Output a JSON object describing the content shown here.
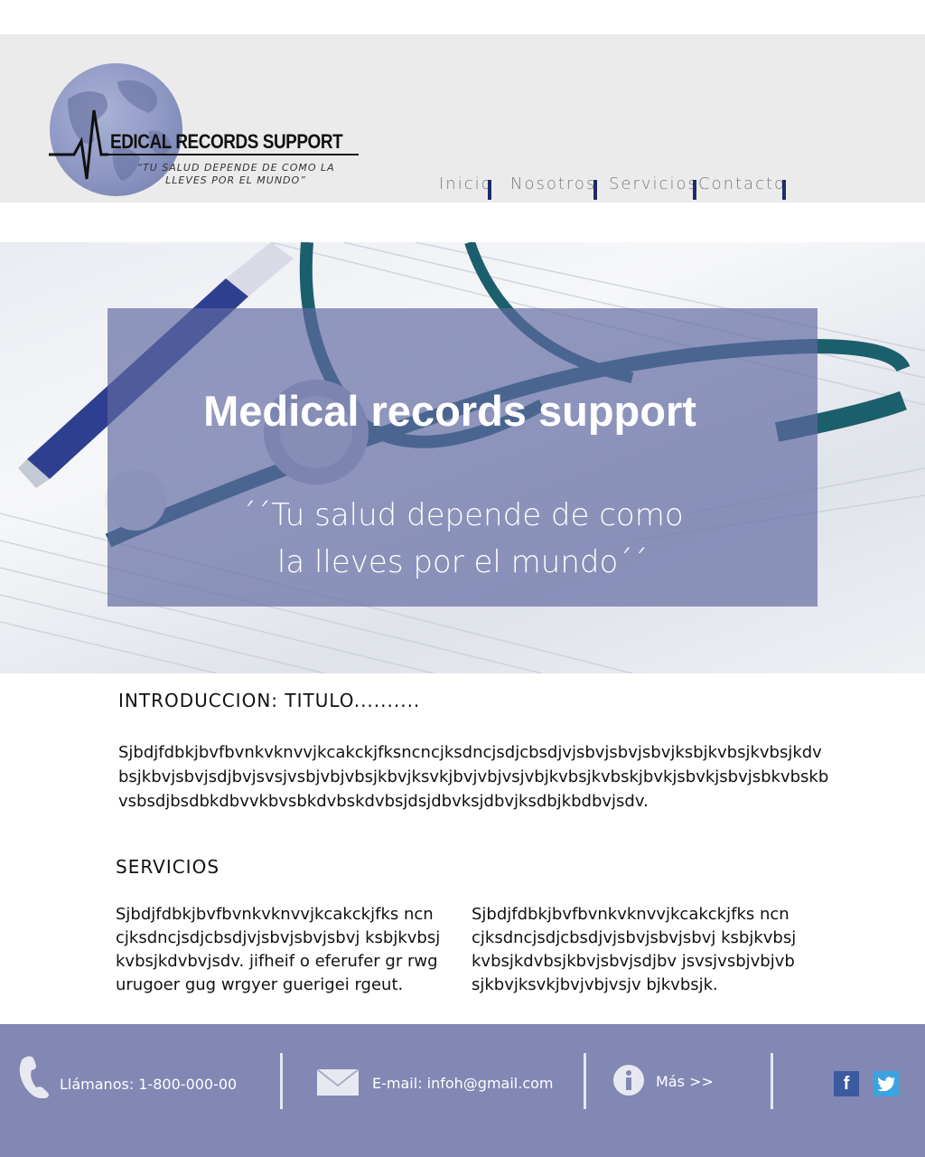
{
  "brand": {
    "logo_title": "EDICAL RECORDS SUPPORT",
    "logo_tagline_line1": "“TU SALUD DEPENDE DE COMO LA",
    "logo_tagline_line2": "LLEVES POR EL MUNDO”"
  },
  "nav": {
    "items": [
      {
        "label": "Inicio"
      },
      {
        "label": "Nosotros"
      },
      {
        "label": "Servicios"
      },
      {
        "label": "Contacto"
      }
    ]
  },
  "hero": {
    "title": "Medical records support",
    "quote_line1": "´´Tu salud depende de como",
    "quote_line2": "la lleves por el mundo´´"
  },
  "intro": {
    "title": "INTRODUCCION: TITULO..........",
    "body": "Sjbdjfdbkjbvfbvnkvknvvjkcakckjfksncncjksdncjsdjcbsdjvjsbvjsbvjsbvjksbjkvbsjkvbsjkdvbsjkbvjsbvjsdjbvjsvsjvsbjvbjvbsjkbvjksvkjbvjvbjvsjvbjkvbsjkvbskjbvkjsbvkjsbvjsbkvbskbvsbsdjbsdbkdbvvkbvsbkdvbskdvbsjdsjdbvksjdbvjksdbjkbdbvjsdv."
  },
  "services": {
    "title": "SERVICIOS",
    "col1": "Sjbdjfdbkjbvfbvnkvknvvjkcakckjfks ncncjksdncjsdjcbsdjvjsbvjsbvjsbvj ksbjkvbsjkvbsjkdvbvjsdv. jifheif o eferufer gr rwgurugoer gug wrgyer guerigei rgeut.",
    "col2": "Sjbdjfdbkjbvfbvnkvknvvjkcakckjfks ncncjksdncjsdjcbsdjvjsbvjsbvjsbvj ksbjkvbsjkvbsjkdvbsjkbvjsbvjsdjbv jsvsjvsbjvbjvbsjkbvjksvkjbvjvbjvsjv bjkvbsjk."
  },
  "footer": {
    "phone_label": "Llámanos: 1-800-000-00",
    "email_label": "E-mail: infoh@gmail.com",
    "more_label": "Más >>",
    "facebook_glyph": "f"
  },
  "colors": {
    "nav_separator": "#1f2a6b",
    "hero_overlay": "#6068a0",
    "footer_bg": "#8287b4",
    "facebook": "#3b5aa0",
    "twitter": "#3aa3e0"
  },
  "icons": [
    "phone-icon",
    "mail-icon",
    "info-icon",
    "facebook-icon",
    "twitter-icon",
    "globe-logo-icon"
  ]
}
